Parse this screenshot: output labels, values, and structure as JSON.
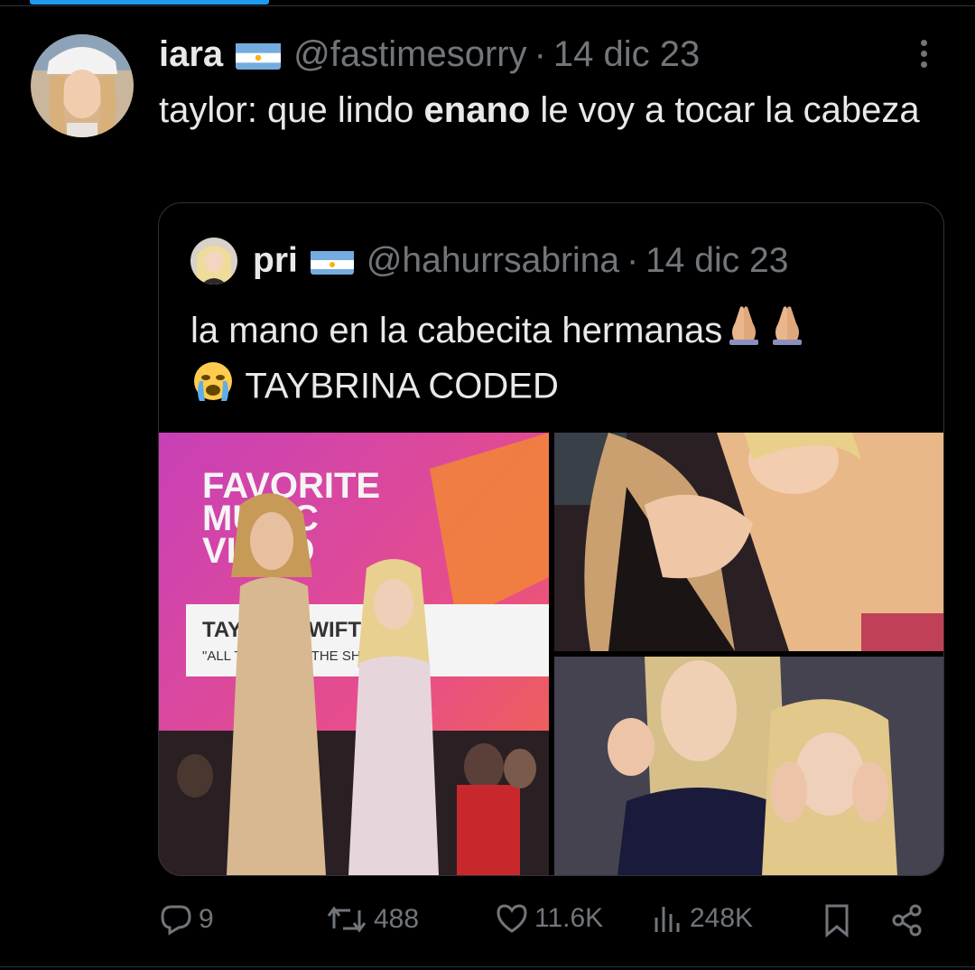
{
  "tweet": {
    "author_name": "iara",
    "author_handle": "@fastimesorry",
    "separator": "·",
    "date": "14 dic 23",
    "text_before": "taylor: que lindo ",
    "text_bold": "enano",
    "text_after": " le voy a tocar la cabeza"
  },
  "quoted": {
    "author_name": "pri",
    "author_handle": "@hahurrsabrina",
    "separator": "·",
    "date": "14 dic 23",
    "line1": "la mano en la cabecita hermanas",
    "line2": "TAYBRINA CODED",
    "sign_lines": [
      "FAVORITE",
      "MUSIC",
      "VIDEO"
    ],
    "sign_caption_top": "TAYLOR SWIFT",
    "sign_caption": "\"ALL TOO WELL: THE SHORT FILM\""
  },
  "actions": {
    "replies": "9",
    "retweets": "488",
    "likes": "11.6K",
    "views": "248K"
  },
  "colors": {
    "background": "#000000",
    "text": "#e7e9ea",
    "muted": "#71767b",
    "border": "#2f3336",
    "accent": "#1d9bf0"
  },
  "icons": [
    "more-vertical-icon",
    "reply-icon",
    "retweet-icon",
    "like-icon",
    "views-icon",
    "bookmark-icon",
    "share-icon",
    "argentina-flag-icon",
    "praying-hands-emoji",
    "crying-face-emoji"
  ]
}
